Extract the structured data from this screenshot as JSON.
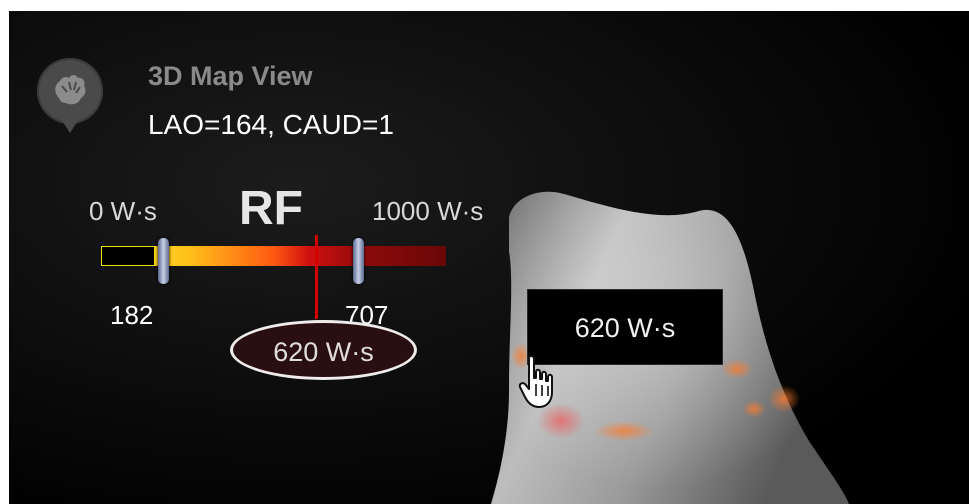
{
  "map_view": {
    "title": "3D Map View",
    "orientation": "LAO=164, CAUD=1",
    "icon": "hand-icon"
  },
  "rf_scale": {
    "title": "RF",
    "min_label": "0 W·s",
    "max_label": "1000 W·s",
    "lower_threshold": "182",
    "upper_threshold": "707",
    "current_value": "620 W·s",
    "gradient_colors": [
      "#ffe93a",
      "#ff5a12",
      "#d01010",
      "#6a0707"
    ],
    "below_range_color": "#e8e000"
  },
  "tooltip": {
    "text": "620 W·s"
  },
  "cursor": {
    "icon": "hand-pointer-icon"
  }
}
